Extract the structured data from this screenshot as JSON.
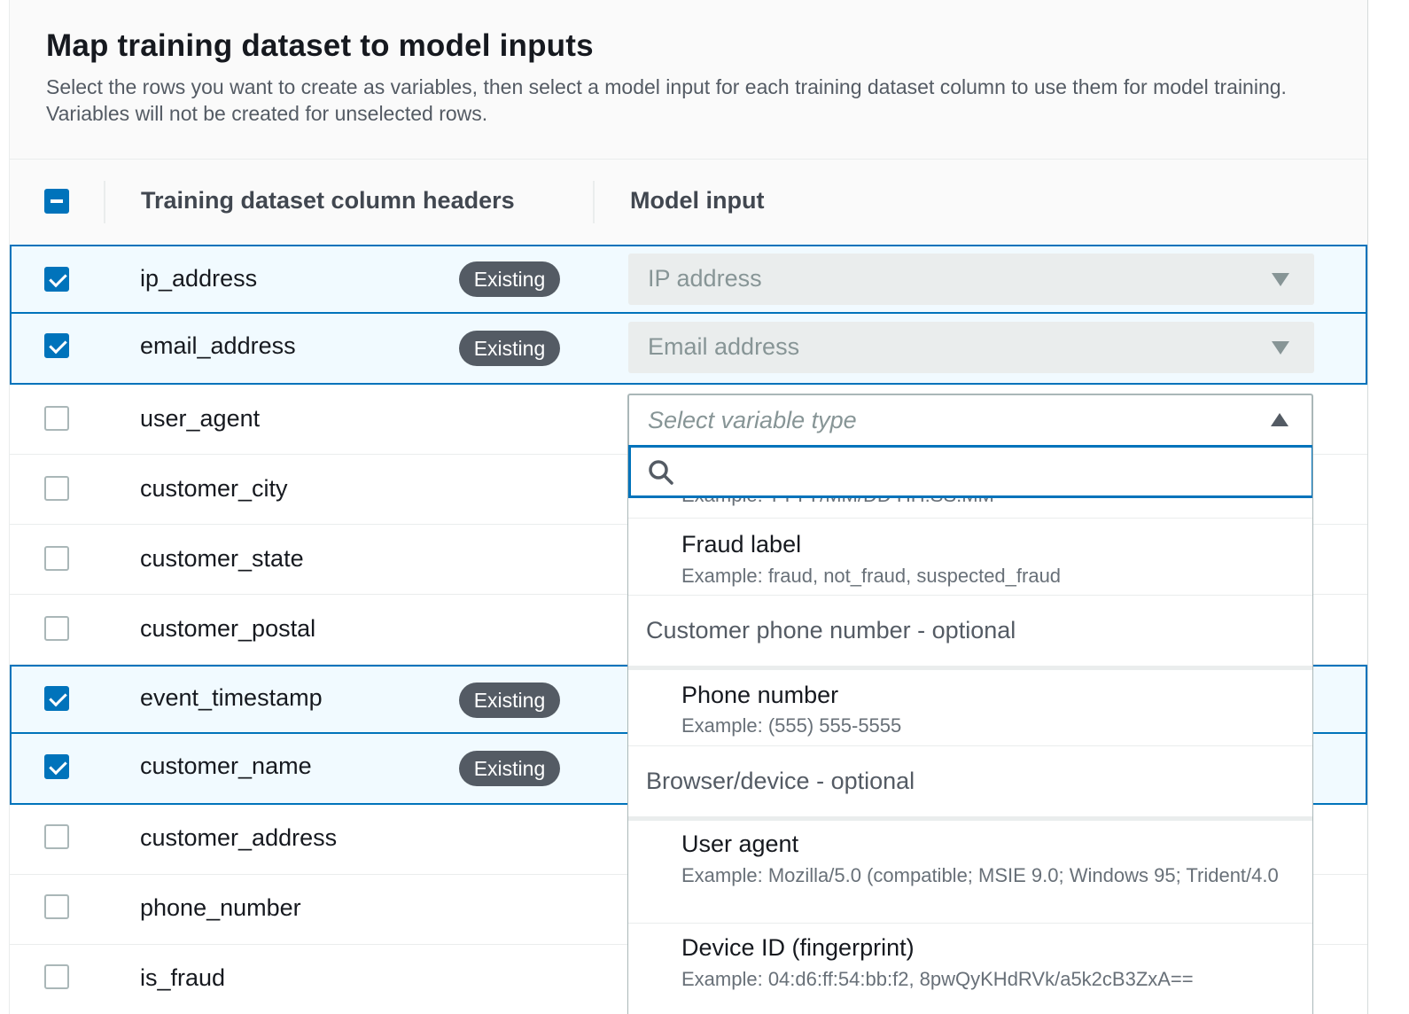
{
  "header": {
    "title": "Map training dataset to model inputs",
    "description": "Select the rows you want to create as variables, then select a model input for each training dataset column to use them for model training. Variables will not be created for unselected rows."
  },
  "table": {
    "col_headers": "Training dataset column headers",
    "col_model_input": "Model input",
    "rows": [
      {
        "label": "ip_address",
        "checked": true,
        "badge": "Existing",
        "model_input": "IP address"
      },
      {
        "label": "email_address",
        "checked": true,
        "badge": "Existing",
        "model_input": "Email address"
      },
      {
        "label": "user_agent",
        "checked": false
      },
      {
        "label": "customer_city",
        "checked": false
      },
      {
        "label": "customer_state",
        "checked": false
      },
      {
        "label": "customer_postal",
        "checked": false
      },
      {
        "label": "event_timestamp",
        "checked": true,
        "badge": "Existing"
      },
      {
        "label": "customer_name",
        "checked": true,
        "badge": "Existing"
      },
      {
        "label": "customer_address",
        "checked": false
      },
      {
        "label": "phone_number",
        "checked": false
      },
      {
        "label": "is_fraud",
        "checked": false
      }
    ]
  },
  "select": {
    "placeholder": "Select variable type"
  },
  "dropdown": {
    "search_value": "",
    "cut_example": "Example: YYYY/MM/DD HH:SS:MM",
    "items": {
      "fraud_label": {
        "label": "Fraud label",
        "example": "Example: fraud, not_fraud, suspected_fraud"
      },
      "group_phone": "Customer phone number - optional",
      "phone_number": {
        "label": "Phone number",
        "example": "Example: (555) 555-5555"
      },
      "group_browser": "Browser/device - optional",
      "user_agent": {
        "label": "User agent",
        "example": "Example: Mozilla/5.0 (compatible; MSIE 9.0; Windows 95; Trident/4.0"
      },
      "device_id": {
        "label": "Device ID (fingerprint)",
        "example": "Example: 04:d6:ff:54:bb:f2, 8pwQyKHdRVk/a5k2cB3ZxA=="
      }
    }
  },
  "colors": {
    "accent": "#0073bb",
    "selected_row_bg": "#f1faff",
    "badge_bg": "#545b64"
  }
}
